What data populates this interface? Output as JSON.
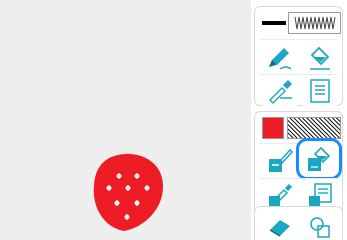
{
  "canvas": {
    "background": "#eeeeee",
    "drawing": "strawberry",
    "strawberry_color": "#ee1c24",
    "seed_color": "#ffffff"
  },
  "toolbar": {
    "accent_color": "#1ba7c1",
    "selection_color": "#1a8cff",
    "top_group": {
      "stroke_width_indicator": "line-thickness",
      "stroke_style_indicator": "zigzag-pattern",
      "tools": [
        {
          "name": "pencil-tool",
          "icon": "pencil-icon",
          "selected": false
        },
        {
          "name": "fill-bucket-tool",
          "icon": "paint-bucket-icon",
          "selected": false
        },
        {
          "name": "eyedropper-tool",
          "icon": "eyedropper-icon",
          "selected": false
        },
        {
          "name": "text-tool",
          "icon": "text-lines-icon",
          "selected": false
        }
      ]
    },
    "fill_group": {
      "fill_color": "#ee1c24",
      "fill_pattern": "diagonal-hatch",
      "tools": [
        {
          "name": "brush-fill-tool",
          "icon": "brush-fill-icon",
          "selected": false
        },
        {
          "name": "bucket-fill-tool",
          "icon": "bucket-fill-icon",
          "selected": true
        },
        {
          "name": "dropper-fill-tool",
          "icon": "dropper-fill-icon",
          "selected": false
        },
        {
          "name": "text-fill-tool",
          "icon": "text-fill-icon",
          "selected": false
        }
      ]
    },
    "bottom_group": {
      "tools": [
        {
          "name": "eraser-tool",
          "icon": "eraser-icon",
          "selected": false
        },
        {
          "name": "shapes-tool",
          "icon": "shapes-icon",
          "selected": false
        }
      ]
    }
  }
}
